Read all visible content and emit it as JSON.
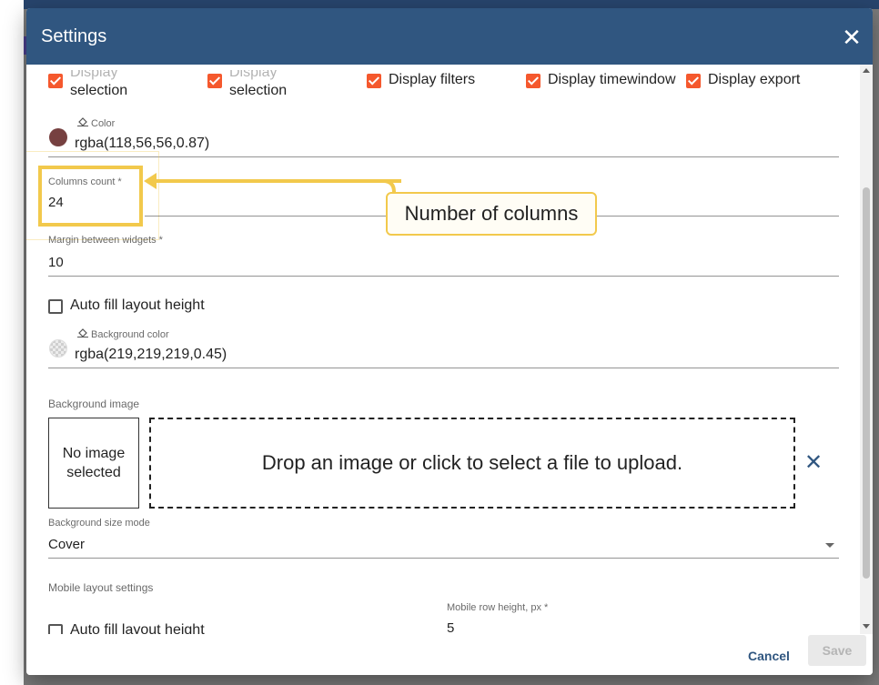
{
  "dialog": {
    "title": "Settings",
    "close_glyph": "✕"
  },
  "top_checkboxes": [
    {
      "line1": "Display",
      "line2": "selection",
      "checked": true
    },
    {
      "line1": "Display",
      "line2": "selection",
      "checked": true
    },
    {
      "label": "Display filters",
      "checked": true
    },
    {
      "label": "Display timewindow",
      "checked": true
    },
    {
      "label": "Display export",
      "checked": true
    }
  ],
  "color_field": {
    "label": "Color",
    "value": "rgba(118,56,56,0.87)",
    "swatch_color": "#764040"
  },
  "columns_count": {
    "label": "Columns count *",
    "value": "24"
  },
  "annotation": {
    "callout_text": "Number of columns",
    "highlight_color": "#f2c94c"
  },
  "margin_field": {
    "label": "Margin between widgets *",
    "value": "10"
  },
  "auto_fill": {
    "label": "Auto fill layout height",
    "checked": false
  },
  "background_color": {
    "label": "Background color",
    "value": "rgba(219,219,219,0.45)"
  },
  "background_image": {
    "section_label": "Background image",
    "no_image_line1": "No image",
    "no_image_line2": "selected",
    "drop_text": "Drop an image or click to select a file to upload.",
    "clear_glyph": "✕"
  },
  "background_size": {
    "label": "Background size mode",
    "value": "Cover"
  },
  "mobile": {
    "section_label": "Mobile layout settings",
    "auto_fill_label": "Auto fill layout height",
    "row_height_label": "Mobile row height, px *",
    "row_height_value": "5"
  },
  "footer": {
    "cancel_label": "Cancel",
    "save_label": "Save"
  },
  "colors": {
    "header": "#305680",
    "accent": "#f5582d",
    "primary_text_button": "#305680"
  }
}
